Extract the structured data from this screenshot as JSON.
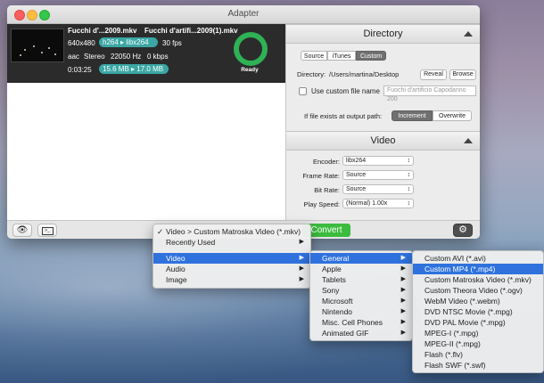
{
  "window": {
    "title": "Adapter"
  },
  "file": {
    "name": "Fucchi d'...2009.mkv",
    "output_name": "Fucchi d'artifi...2009(1).mkv",
    "resolution": "640x480",
    "codec_in": "h264",
    "codec_out": "libx264",
    "fps": "30 fps",
    "audio_codec": "aac",
    "channels": "Stereo",
    "sample_rate": "22050 Hz",
    "bitrate": "0 kbps",
    "duration": "0:03:25",
    "size_in": "15.6 MB",
    "size_out": "17.0 MB",
    "status": "Ready"
  },
  "directory": {
    "header": "Directory",
    "tabs": [
      "Source",
      "iTunes",
      "Custom"
    ],
    "selected_tab": "Custom",
    "label": "Directory:",
    "path": "/Users/martina/Desktop",
    "reveal": "Reveal",
    "browse": "Browse",
    "custom_name_label": "Use custom file name",
    "custom_name_placeholder": "Fuochi d'artificio Capodanno 200",
    "exists_label": "If file exists at output path:",
    "exists_options": [
      "Increment",
      "Overwrite"
    ],
    "exists_selected": "Increment"
  },
  "video": {
    "header": "Video",
    "rows": [
      {
        "label": "Encoder:",
        "value": "libx264"
      },
      {
        "label": "Frame Rate:",
        "value": "Source"
      },
      {
        "label": "Bit Rate:",
        "value": "Source"
      },
      {
        "label": "Play Speed:",
        "value": "(Normal) 1.00x"
      }
    ]
  },
  "bottombar": {
    "convert": "Convert"
  },
  "menu1": {
    "items": [
      {
        "label": "Video > Custom Matroska Video (*.mkv)",
        "checked": true
      },
      {
        "label": "Recently Used",
        "submenu": true
      },
      {
        "label": "Video",
        "submenu": true,
        "selected": true
      },
      {
        "label": "Audio",
        "submenu": true
      },
      {
        "label": "Image",
        "submenu": true
      }
    ]
  },
  "menu2": {
    "items": [
      {
        "label": "General",
        "selected": true
      },
      {
        "label": "Apple"
      },
      {
        "label": "Tablets"
      },
      {
        "label": "Sony"
      },
      {
        "label": "Microsoft"
      },
      {
        "label": "Nintendo"
      },
      {
        "label": "Misc. Cell Phones"
      },
      {
        "label": "Animated GIF"
      }
    ]
  },
  "menu3": {
    "items": [
      {
        "label": "Custom AVI (*.avi)"
      },
      {
        "label": "Custom MP4 (*.mp4)",
        "selected": true
      },
      {
        "label": "Custom Matroska Video (*.mkv)"
      },
      {
        "label": "Custom Theora Video (*.ogv)"
      },
      {
        "label": "WebM Video (*.webm)"
      },
      {
        "label": "DVD NTSC Movie (*.mpg)"
      },
      {
        "label": "DVD PAL Movie (*.mpg)"
      },
      {
        "label": "MPEG-I (*.mpg)"
      },
      {
        "label": "MPEG-II (*.mpg)"
      },
      {
        "label": "Flash (*.flv)"
      },
      {
        "label": "Flash SWF (*.swf)"
      }
    ]
  },
  "colors": {
    "accent": "#2f72de",
    "convert": "#3cbc3e",
    "progress": "#2fb156",
    "pill": "#3aa7a4"
  }
}
